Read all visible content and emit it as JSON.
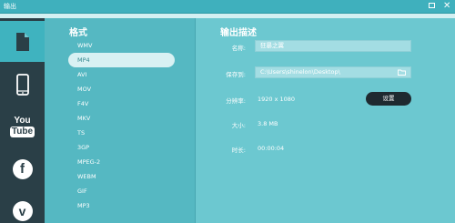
{
  "window": {
    "title": "输出",
    "maximize_icon": "maximize-icon",
    "close_icon": "close-icon"
  },
  "sidebar": {
    "items": [
      {
        "name": "file",
        "icon": "file-icon",
        "active": true
      },
      {
        "name": "device",
        "icon": "phone-icon",
        "active": false
      },
      {
        "name": "youtube",
        "icon": "youtube-icon",
        "label_top": "You",
        "label_bottom": "Tube",
        "active": false
      },
      {
        "name": "facebook",
        "icon": "facebook-icon",
        "glyph": "f",
        "active": false
      },
      {
        "name": "vimeo",
        "icon": "vimeo-icon",
        "glyph": "v",
        "active": false
      }
    ]
  },
  "formats": {
    "title": "格式",
    "items": [
      "WMV",
      "MP4",
      "AVI",
      "MOV",
      "F4V",
      "MKV",
      "TS",
      "3GP",
      "MPEG-2",
      "WEBM",
      "GIF",
      "MP3"
    ],
    "selected": "MP4"
  },
  "description": {
    "title": "输出描述",
    "name_label": "名称:",
    "name_value": "狂暴之翼",
    "save_label": "保存到:",
    "save_value": "C:\\Users\\shinelon\\Desktop\\",
    "folder_icon": "folder-icon",
    "resolution_label": "分辨率:",
    "resolution_value": "1920 x 1080",
    "settings_button": "设置",
    "size_label": "大小:",
    "size_value": "3.8 MB",
    "duration_label": "时长:",
    "duration_value": "00:00:04"
  },
  "colors": {
    "sidebar": "#2a3f47",
    "sidebar_active": "#3fb3bf",
    "format_panel": "#55b8c2",
    "description_panel": "#6cc8d0",
    "selected_item": "#d8f1f3",
    "button": "#1f2a30"
  }
}
